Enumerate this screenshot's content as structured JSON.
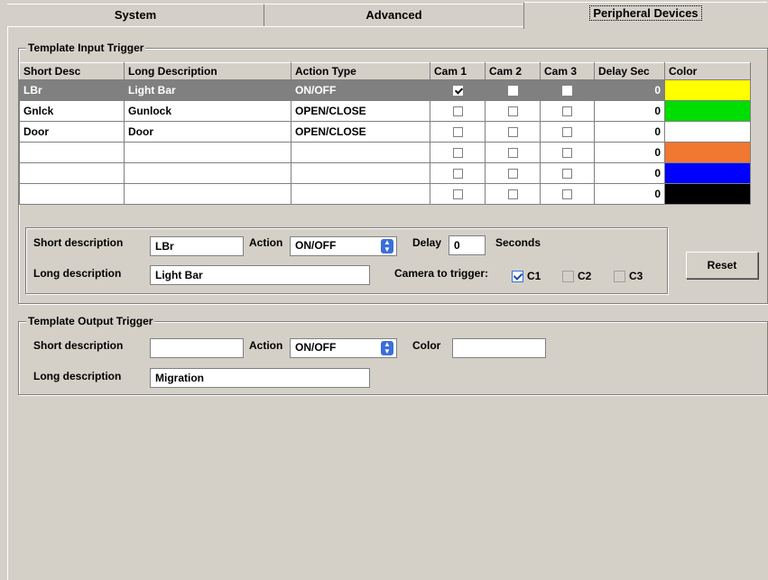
{
  "tabs": [
    "System",
    "Advanced",
    "Peripheral Devices"
  ],
  "input_group": {
    "title": "Template Input Trigger",
    "columns": [
      "Short Desc",
      "Long Description",
      "Action Type",
      "Cam 1",
      "Cam 2",
      "Cam 3",
      "Delay Sec",
      "Color"
    ],
    "rows": [
      {
        "short": "LBr",
        "long": "Light Bar",
        "action": "ON/OFF",
        "cam1": true,
        "cam2": false,
        "cam3": false,
        "delay": "0",
        "color": "#ffff00",
        "selected": true
      },
      {
        "short": "Gnlck",
        "long": "Gunlock",
        "action": "OPEN/CLOSE",
        "cam1": false,
        "cam2": false,
        "cam3": false,
        "delay": "0",
        "color": "#00dd00",
        "selected": false
      },
      {
        "short": "Door",
        "long": "Door",
        "action": "OPEN/CLOSE",
        "cam1": false,
        "cam2": false,
        "cam3": false,
        "delay": "0",
        "color": "#ffffff",
        "selected": false
      },
      {
        "short": "",
        "long": "",
        "action": "",
        "cam1": false,
        "cam2": false,
        "cam3": false,
        "delay": "0",
        "color": "#f07830",
        "selected": false
      },
      {
        "short": "",
        "long": "",
        "action": "",
        "cam1": false,
        "cam2": false,
        "cam3": false,
        "delay": "0",
        "color": "#0000ff",
        "selected": false
      },
      {
        "short": "",
        "long": "",
        "action": "",
        "cam1": false,
        "cam2": false,
        "cam3": false,
        "delay": "0",
        "color": "#000000",
        "selected": false
      }
    ],
    "short_label": "Short description",
    "short_value": "LBr",
    "action_label": "Action",
    "action_value": "ON/OFF",
    "delay_label": "Delay",
    "delay_value": "0",
    "seconds_label": "Seconds",
    "long_label": "Long description",
    "long_value": "Light Bar",
    "camera_label": "Camera to trigger:",
    "cameras": [
      {
        "label": "C1",
        "checked": true
      },
      {
        "label": "C2",
        "checked": false
      },
      {
        "label": "C3",
        "checked": false
      }
    ],
    "reset_label": "Reset"
  },
  "output_group": {
    "title": "Template Output Trigger",
    "short_label": "Short description",
    "short_value": "",
    "action_label": "Action",
    "action_value": "ON/OFF",
    "color_label": "Color",
    "color_value": "",
    "long_label": "Long description",
    "long_value": "Migration"
  }
}
